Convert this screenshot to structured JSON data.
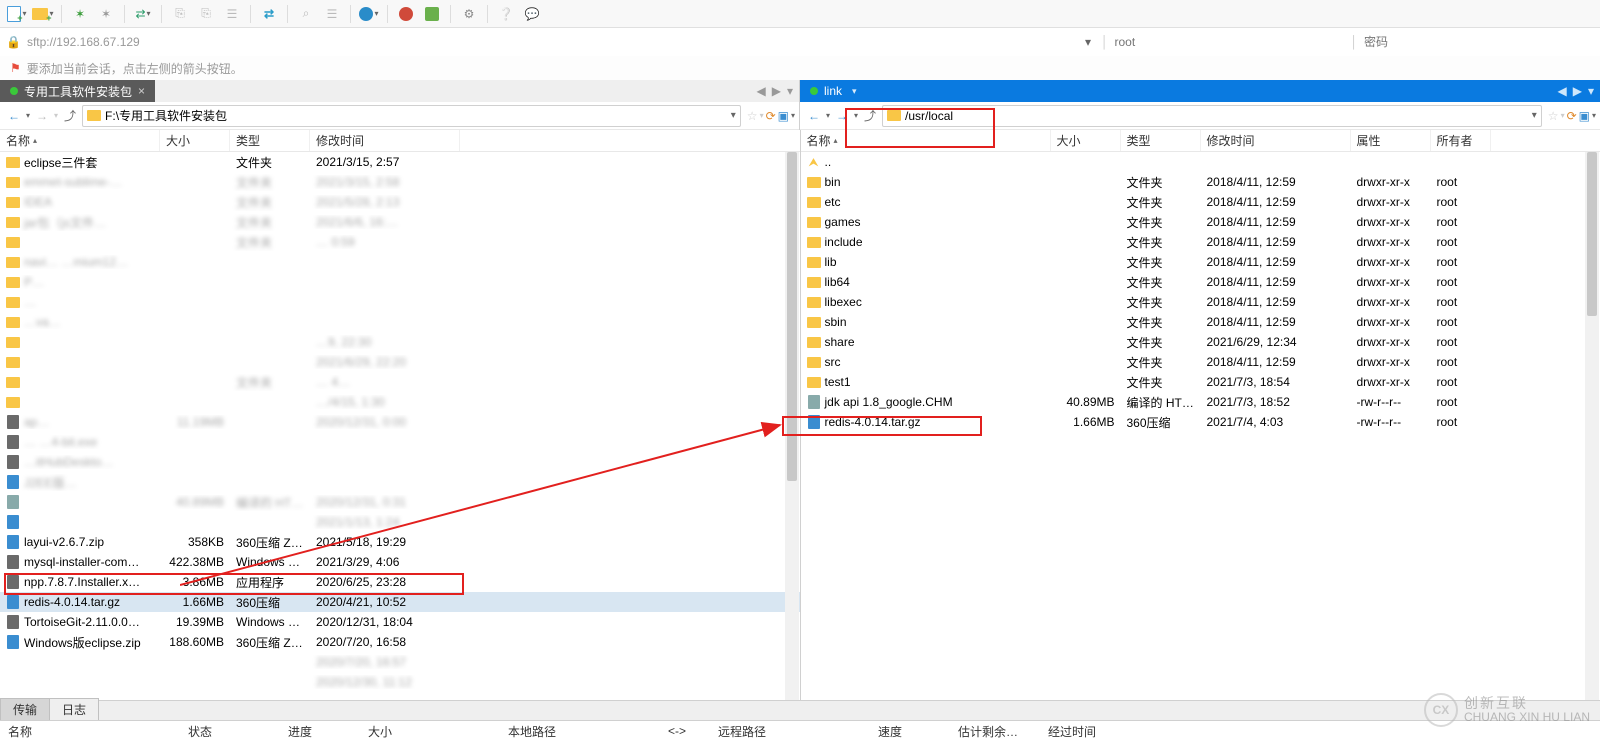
{
  "toolbar": {},
  "address": {
    "url": "sftp://192.168.67.129",
    "user_placeholder": "root",
    "pass_placeholder": "密码"
  },
  "hint": "要添加当前会话，点击左侧的箭头按钮。",
  "left_tab": {
    "title": "专用工具软件安装包"
  },
  "right_tab": {
    "title": "link"
  },
  "left_nav": {
    "path": "F:\\专用工具软件安装包"
  },
  "right_nav": {
    "path": "/usr/local"
  },
  "left_cols": {
    "name": "名称",
    "size": "大小",
    "type": "类型",
    "date": "修改时间"
  },
  "right_cols": {
    "name": "名称",
    "size": "大小",
    "type": "类型",
    "date": "修改时间",
    "perm": "属性",
    "owner": "所有者"
  },
  "left_rows": [
    {
      "icon": "folder",
      "name": "eclipse三件套",
      "size": "",
      "type": "文件夹",
      "date": "2021/3/15, 2:57"
    },
    {
      "icon": "folder",
      "name": "emmet-sublime-…",
      "size": "",
      "type": "文件夹",
      "date": "2021/3/15, 2:58",
      "blur": true
    },
    {
      "icon": "folder",
      "name": "IDEA",
      "size": "",
      "type": "文件夹",
      "date": "2021/5/28, 2:13",
      "blur": true
    },
    {
      "icon": "folder",
      "name": "jar包（js文件…",
      "size": "",
      "type": "文件夹",
      "date": "2021/6/6, 16:…",
      "blur": true
    },
    {
      "icon": "folder",
      "name": "",
      "size": "",
      "type": "文件夹",
      "date": "… 0:59",
      "blur": true
    },
    {
      "icon": "folder",
      "name": "navi…  …mium12…",
      "size": "",
      "type": "",
      "date": "",
      "blur": true
    },
    {
      "icon": "folder",
      "name": "P…",
      "size": "",
      "type": "",
      "date": "",
      "blur": true
    },
    {
      "icon": "folder",
      "name": "…",
      "size": "",
      "type": "",
      "date": "",
      "blur": true
    },
    {
      "icon": "folder",
      "name": "…va…",
      "size": "",
      "type": "",
      "date": "",
      "blur": true
    },
    {
      "icon": "folder",
      "name": "",
      "size": "",
      "type": "",
      "date": "…9, 22:30",
      "blur": true
    },
    {
      "icon": "folder",
      "name": "",
      "size": "",
      "type": "",
      "date": "2021/6/29, 22:20",
      "blur": true
    },
    {
      "icon": "folder",
      "name": "",
      "size": "",
      "type": "文件夹",
      "date": "… 4…",
      "blur": true
    },
    {
      "icon": "folder",
      "name": "",
      "size": "",
      "type": "",
      "date": "…/4/15, 1:30",
      "blur": true
    },
    {
      "icon": "exe",
      "name": "ap…",
      "size": "11.19MB",
      "type": "",
      "date": "2020/12/31, 0:00",
      "blur": true
    },
    {
      "icon": "exe",
      "name": "…   …4-bit.exe",
      "size": "",
      "type": "",
      "date": "",
      "blur": true
    },
    {
      "icon": "exe",
      "name": "…itHubDeskto…",
      "size": "",
      "type": "",
      "date": "",
      "blur": true
    },
    {
      "icon": "zip",
      "name": "J2EE版…",
      "size": "",
      "type": "",
      "date": "",
      "blur": true
    },
    {
      "icon": "chm",
      "name": "",
      "size": "40.89MB",
      "type": "编译的 HT…",
      "date": "2020/12/31, 0:31",
      "blur": true
    },
    {
      "icon": "zip",
      "name": "",
      "size": "",
      "type": "",
      "date": "2021/1/13, 1:24",
      "blur": true
    },
    {
      "icon": "zip",
      "name": "layui-v2.6.7.zip",
      "size": "358KB",
      "type": "360压缩 ZI…",
      "date": "2021/5/18, 19:29"
    },
    {
      "icon": "exe",
      "name": "mysql-installer-com…",
      "size": "422.38MB",
      "type": "Windows …",
      "date": "2021/3/29, 4:06"
    },
    {
      "icon": "exe",
      "name": "npp.7.8.7.Installer.x…",
      "size": "3.86MB",
      "type": "应用程序",
      "date": "2020/6/25, 23:28"
    },
    {
      "icon": "zip",
      "name": "redis-4.0.14.tar.gz",
      "size": "1.66MB",
      "type": "360压缩",
      "date": "2020/4/21, 10:52",
      "selected": true
    },
    {
      "icon": "exe",
      "name": "TortoiseGit-2.11.0.0…",
      "size": "19.39MB",
      "type": "Windows …",
      "date": "2020/12/31, 18:04"
    },
    {
      "icon": "zip",
      "name": "Windows版eclipse.zip",
      "size": "188.60MB",
      "type": "360压缩 ZI…",
      "date": "2020/7/20, 16:58"
    },
    {
      "icon": "",
      "name": "",
      "size": "",
      "type": "",
      "date": "2020/7/20, 16:57",
      "blur": true
    },
    {
      "icon": "",
      "name": "",
      "size": "",
      "type": "",
      "date": "2020/12/30, 11:12",
      "blur": true
    }
  ],
  "right_rows": [
    {
      "icon": "up",
      "name": "..",
      "size": "",
      "type": "",
      "date": "",
      "perm": "",
      "owner": ""
    },
    {
      "icon": "folder",
      "name": "bin",
      "size": "",
      "type": "文件夹",
      "date": "2018/4/11, 12:59",
      "perm": "drwxr-xr-x",
      "owner": "root"
    },
    {
      "icon": "folder",
      "name": "etc",
      "size": "",
      "type": "文件夹",
      "date": "2018/4/11, 12:59",
      "perm": "drwxr-xr-x",
      "owner": "root"
    },
    {
      "icon": "folder",
      "name": "games",
      "size": "",
      "type": "文件夹",
      "date": "2018/4/11, 12:59",
      "perm": "drwxr-xr-x",
      "owner": "root"
    },
    {
      "icon": "folder",
      "name": "include",
      "size": "",
      "type": "文件夹",
      "date": "2018/4/11, 12:59",
      "perm": "drwxr-xr-x",
      "owner": "root"
    },
    {
      "icon": "folder",
      "name": "lib",
      "size": "",
      "type": "文件夹",
      "date": "2018/4/11, 12:59",
      "perm": "drwxr-xr-x",
      "owner": "root"
    },
    {
      "icon": "folder",
      "name": "lib64",
      "size": "",
      "type": "文件夹",
      "date": "2018/4/11, 12:59",
      "perm": "drwxr-xr-x",
      "owner": "root"
    },
    {
      "icon": "folder",
      "name": "libexec",
      "size": "",
      "type": "文件夹",
      "date": "2018/4/11, 12:59",
      "perm": "drwxr-xr-x",
      "owner": "root"
    },
    {
      "icon": "folder",
      "name": "sbin",
      "size": "",
      "type": "文件夹",
      "date": "2018/4/11, 12:59",
      "perm": "drwxr-xr-x",
      "owner": "root"
    },
    {
      "icon": "folder",
      "name": "share",
      "size": "",
      "type": "文件夹",
      "date": "2021/6/29, 12:34",
      "perm": "drwxr-xr-x",
      "owner": "root"
    },
    {
      "icon": "folder",
      "name": "src",
      "size": "",
      "type": "文件夹",
      "date": "2018/4/11, 12:59",
      "perm": "drwxr-xr-x",
      "owner": "root"
    },
    {
      "icon": "folder",
      "name": "test1",
      "size": "",
      "type": "文件夹",
      "date": "2021/7/3, 18:54",
      "perm": "drwxr-xr-x",
      "owner": "root"
    },
    {
      "icon": "chm",
      "name": "jdk api 1.8_google.CHM",
      "size": "40.89MB",
      "type": "编译的 HT…",
      "date": "2021/7/3, 18:52",
      "perm": "-rw-r--r--",
      "owner": "root"
    },
    {
      "icon": "zip",
      "name": "redis-4.0.14.tar.gz",
      "size": "1.66MB",
      "type": "360压缩",
      "date": "2021/7/4, 4:03",
      "perm": "-rw-r--r--",
      "owner": "root"
    }
  ],
  "bottom_tabs": {
    "t1": "传输",
    "t2": "日志"
  },
  "bottom_cols": {
    "name": "名称",
    "status": "状态",
    "progress": "进度",
    "size": "大小",
    "local": "本地路径",
    "arrow": "<->",
    "remote": "远程路径",
    "speed": "速度",
    "eta": "估计剩余…",
    "elapsed": "经过时间"
  },
  "watermark": {
    "cn": "创新互联",
    "en": "CHUANG XIN HU LIAN"
  }
}
